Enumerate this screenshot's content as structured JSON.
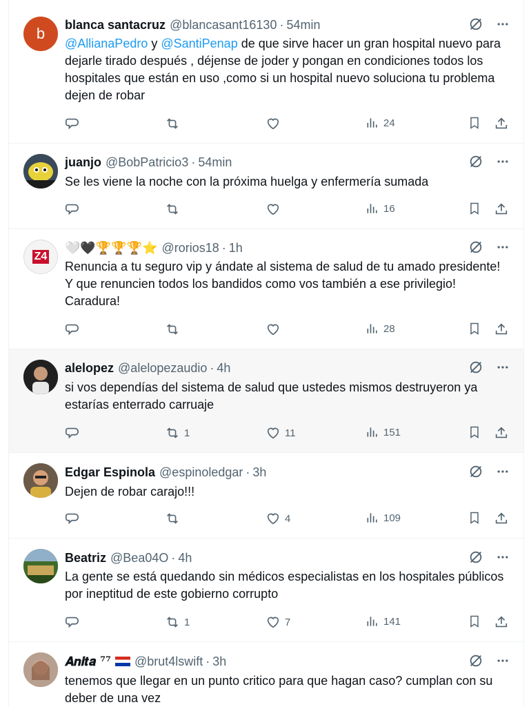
{
  "tweets": [
    {
      "name": "blanca santacruz",
      "handle": "@blancasant16130",
      "time": "54min",
      "mention1": "@AllianaPedro",
      "joiner": " y ",
      "mention2": "@SantiPenap",
      "text_after": " de que sirve hacer un gran hospital nuevo para dejarle tirado después , déjense de joder y pongan en condiciones todos los hospitales que están en uso ,como si un hospital nuevo soluciona tu problema dejen de robar",
      "replies": "",
      "retweets": "",
      "likes": "",
      "views": "24",
      "avatar_letter": "b",
      "avatar_color": "#d04a1f"
    },
    {
      "name": "juanjo",
      "handle": "@BobPatricio3",
      "time": "54min",
      "text": "Se les viene la noche con la próxima huelga y enfermería sumada",
      "replies": "",
      "retweets": "",
      "likes": "",
      "views": "16"
    },
    {
      "name": "🤍🖤🏆🏆🏆⭐",
      "handle": "@rorios18",
      "time": "1h",
      "text": "Renuncia a tu seguro vip y ándate al sistema de salud de tu amado presidente! Y que renuncien todos los bandidos como vos también a ese privilegio! Caradura!",
      "replies": "",
      "retweets": "",
      "likes": "",
      "views": "28",
      "avatar_text": "Z4"
    },
    {
      "name": "alelopez",
      "handle": "@alelopezaudio",
      "time": "4h",
      "text": "si vos dependías del sistema de salud que ustedes mismos destruyeron ya estarías enterrado carruaje",
      "replies": "",
      "retweets": "1",
      "likes": "11",
      "views": "151"
    },
    {
      "name": "Edgar Espinola",
      "handle": "@espinoledgar",
      "time": "3h",
      "text": "Dejen de robar carajo!!!",
      "replies": "",
      "retweets": "",
      "likes": "4",
      "views": "109"
    },
    {
      "name": "Beatriz",
      "handle": "@Bea04O",
      "time": "4h",
      "text": "La gente se está quedando sin médicos especialistas en los hospitales públicos por ineptitud de este gobierno corrupto",
      "replies": "",
      "retweets": "1",
      "likes": "7",
      "views": "141"
    },
    {
      "name": "𝑨𝒏𝒊𝒕𝒂 ⁷⁷",
      "handle": "@brut4lswift",
      "time": "3h",
      "text": "tenemos que llegar en un punto critico para que hagan caso? cumplan con su deber de una vez",
      "replies": "",
      "retweets": "",
      "likes": "",
      "views": ""
    }
  ]
}
